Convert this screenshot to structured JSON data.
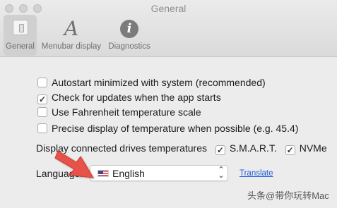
{
  "window": {
    "title": "General"
  },
  "toolbar": {
    "items": [
      {
        "label": "General",
        "icon": "general-switch-icon",
        "selected": true
      },
      {
        "label": "Menubar display",
        "icon": "font-a-icon",
        "glyph": "A"
      },
      {
        "label": "Diagnostics",
        "icon": "info-icon",
        "glyph": "i"
      }
    ]
  },
  "options": {
    "autostart": {
      "label": "Autostart minimized with system (recommended)",
      "checked": false
    },
    "check_updates": {
      "label": "Check for updates when the app starts",
      "checked": true
    },
    "fahrenheit": {
      "label": "Use Fahrenheit temperature scale",
      "checked": false
    },
    "precise": {
      "label": "Precise display of temperature when possible (e.g. 45.4)",
      "checked": false
    }
  },
  "drives": {
    "label": "Display connected drives temperatures",
    "smart": {
      "label": "S.M.A.R.T.",
      "checked": true
    },
    "nvme": {
      "label": "NVMe",
      "checked": true
    }
  },
  "language": {
    "label": "Language:",
    "selected": "English",
    "flag": "us-flag-icon",
    "translate_link": "Translate"
  },
  "watermark": "头条@带你玩转Mac",
  "colors": {
    "link": "#1f5bd7",
    "arrow": "#e8524a"
  },
  "check_glyph": "✓",
  "chevron_glyph": "⌃⌄"
}
